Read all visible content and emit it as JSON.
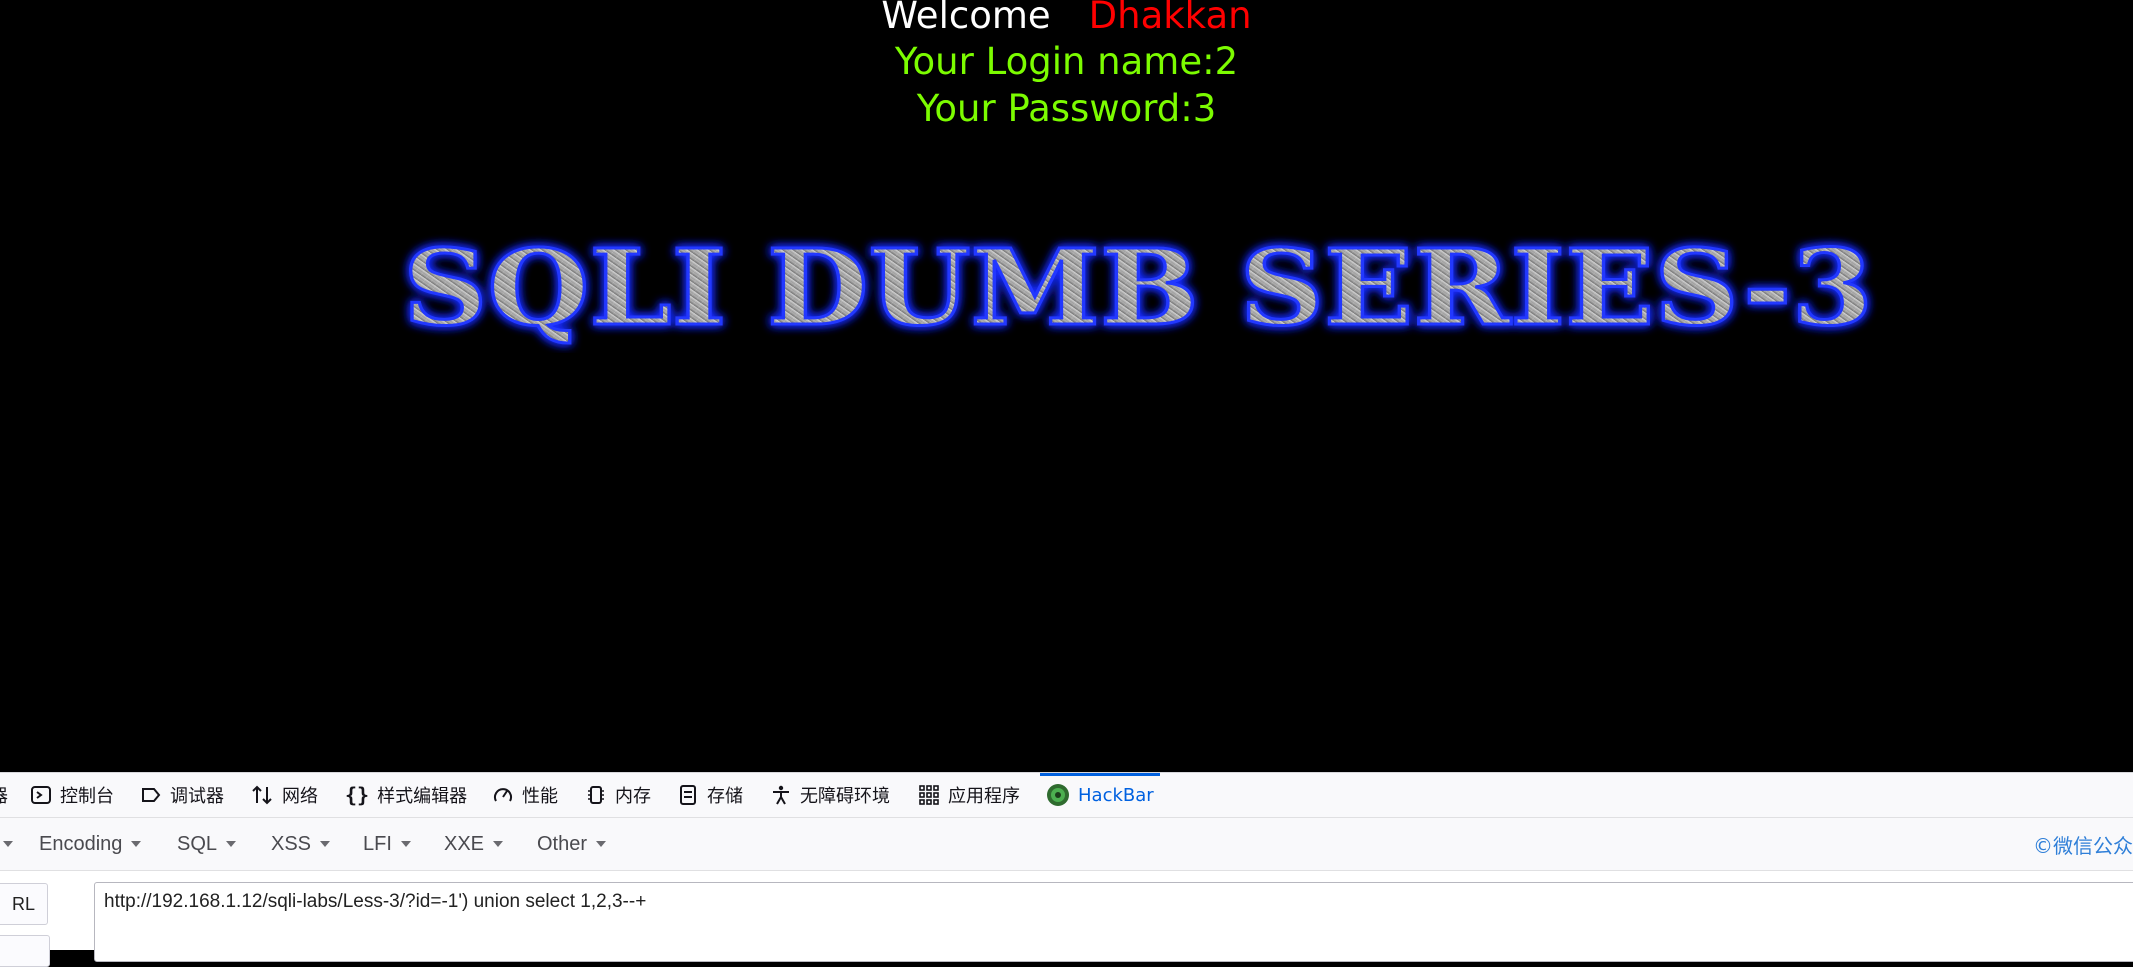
{
  "page": {
    "welcome_label": "Welcome",
    "welcome_name": "Dhakkan",
    "login_line": "Your Login name:2",
    "password_line": "Your Password:3",
    "banner_text": "SQLI DUMB SERIES-3"
  },
  "devtools": {
    "tabs": [
      {
        "label": "器",
        "icon": "inspector-icon"
      },
      {
        "label": "控制台",
        "icon": "console-icon"
      },
      {
        "label": "调试器",
        "icon": "debugger-icon"
      },
      {
        "label": "网络",
        "icon": "network-icon"
      },
      {
        "label": "样式编辑器",
        "icon": "style-editor-icon"
      },
      {
        "label": "性能",
        "icon": "performance-icon"
      },
      {
        "label": "内存",
        "icon": "memory-icon"
      },
      {
        "label": "存储",
        "icon": "storage-icon"
      },
      {
        "label": "无障碍环境",
        "icon": "accessibility-icon"
      },
      {
        "label": "应用程序",
        "icon": "application-icon"
      },
      {
        "label": "HackBar",
        "icon": "hackbar-icon",
        "active": true
      }
    ],
    "accent_color": "#0061e0"
  },
  "hackbar": {
    "menu": [
      "Encoding",
      "SQL",
      "XSS",
      "LFI",
      "XXE",
      "Other"
    ],
    "watermark": "©微信公众",
    "url_button": "RL",
    "url_value": "http://192.168.1.12/sqli-labs/Less-3/?id=-1') union select 1,2,3--+"
  },
  "colors": {
    "page_bg": "#000000",
    "welcome_name": "#ff0000",
    "info_text": "#7CFC00",
    "banner_glow": "#1a2cff"
  }
}
